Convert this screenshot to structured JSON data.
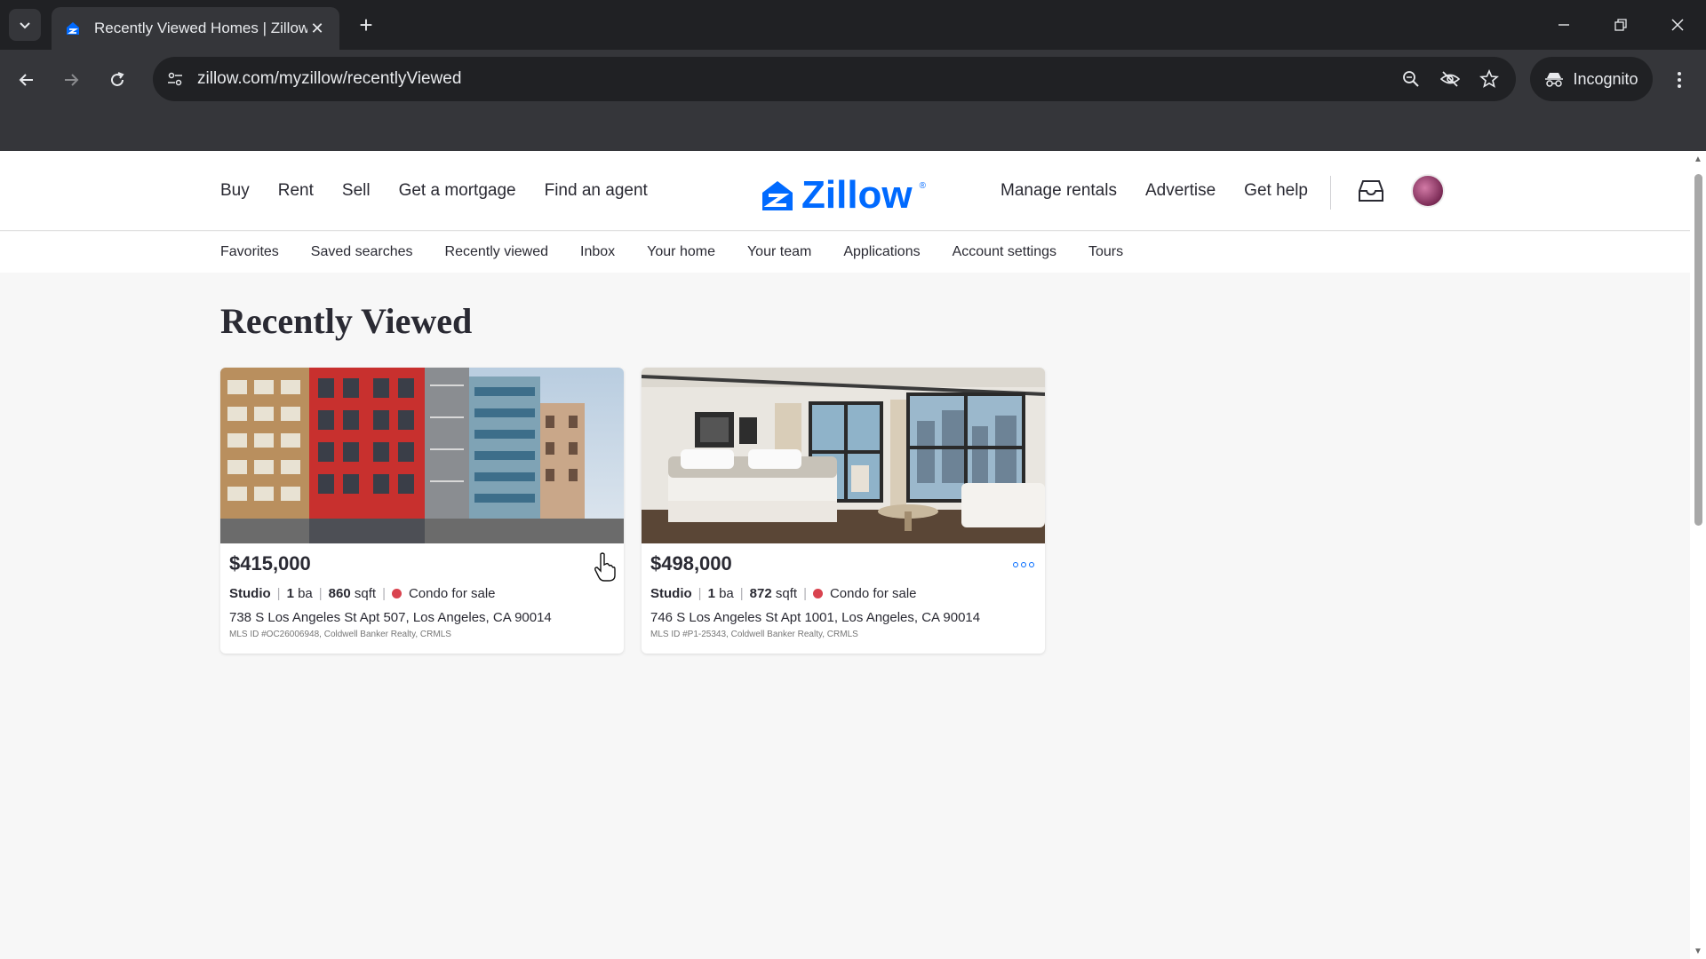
{
  "browser": {
    "tab_title": "Recently Viewed Homes | Zillow",
    "url": "zillow.com/myzillow/recentlyViewed",
    "incognito_label": "Incognito"
  },
  "header": {
    "nav_left": [
      "Buy",
      "Rent",
      "Sell",
      "Get a mortgage",
      "Find an agent"
    ],
    "logo_text": "Zillow",
    "nav_right": [
      "Manage rentals",
      "Advertise",
      "Get help"
    ]
  },
  "subnav": [
    "Favorites",
    "Saved searches",
    "Recently viewed",
    "Inbox",
    "Your home",
    "Your team",
    "Applications",
    "Account settings",
    "Tours"
  ],
  "page_title": "Recently Viewed",
  "listings": [
    {
      "price": "$415,000",
      "beds": "Studio",
      "baths": "1",
      "baths_unit": "ba",
      "sqft": "860",
      "sqft_unit": "sqft",
      "status": "Condo for sale",
      "address": "738 S Los Angeles St Apt 507, Los Angeles, CA 90014",
      "mls": "MLS ID #OC26006948, Coldwell Banker Realty, CRMLS"
    },
    {
      "price": "$498,000",
      "beds": "Studio",
      "baths": "1",
      "baths_unit": "ba",
      "sqft": "872",
      "sqft_unit": "sqft",
      "status": "Condo for sale",
      "address": "746 S Los Angeles St Apt 1001, Los Angeles, CA 90014",
      "mls": "MLS ID #P1-25343, Coldwell Banker Realty, CRMLS"
    }
  ],
  "colors": {
    "brand": "#006aff",
    "status_dot": "#d9434f"
  }
}
